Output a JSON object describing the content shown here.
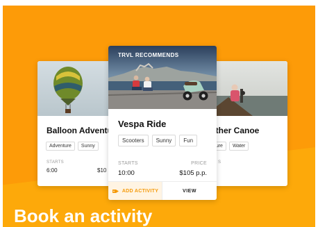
{
  "cards": {
    "left": {
      "title": "Balloon Adventur",
      "tags": [
        "Adventure",
        "Sunny"
      ],
      "starts_label": "STARTS",
      "starts_value": "6:00",
      "price_value": "$10"
    },
    "main": {
      "badge": "TRVL RECOMMENDS",
      "title": "Vespa Ride",
      "tags": [
        "Scooters",
        "Sunny",
        "Fun"
      ],
      "starts_label": "STARTS",
      "starts_value": "10:00",
      "price_label": "PRICE",
      "price_value": "$105 p.p.",
      "add_label": "ADD ACTIVITY",
      "view_label": "VIEW"
    },
    "right": {
      "title": "ether Canoe",
      "tags": [
        "nture",
        "Water"
      ],
      "starts_label": "S"
    }
  },
  "heading": "Book an activity",
  "colors": {
    "brand_orange": "#fd9b08",
    "accent_text": "#f59a0a",
    "add_bg": "#fff4e3"
  }
}
